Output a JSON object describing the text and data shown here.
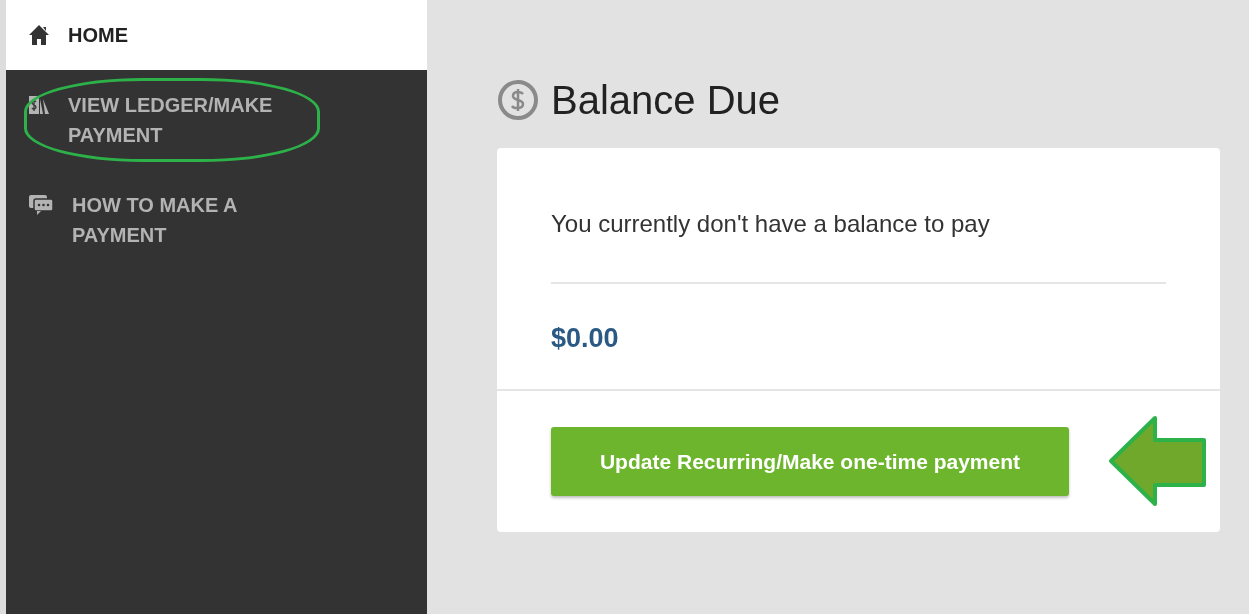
{
  "sidebar": {
    "items": [
      {
        "label": "HOME",
        "kind": "home",
        "selected": true,
        "highlighted": false
      },
      {
        "label": "VIEW LEDGER/MAKE PAYMENT",
        "kind": "ledger",
        "selected": false,
        "highlighted": true
      },
      {
        "label": "HOW TO MAKE A PAYMENT",
        "kind": "help",
        "selected": false,
        "highlighted": false
      }
    ]
  },
  "main": {
    "title": "Balance Due",
    "message": "You currently don't have a balance to pay",
    "amount": "$0.00",
    "button": {
      "label": "Update Recurring/Make one-time payment",
      "pointed": true
    }
  }
}
